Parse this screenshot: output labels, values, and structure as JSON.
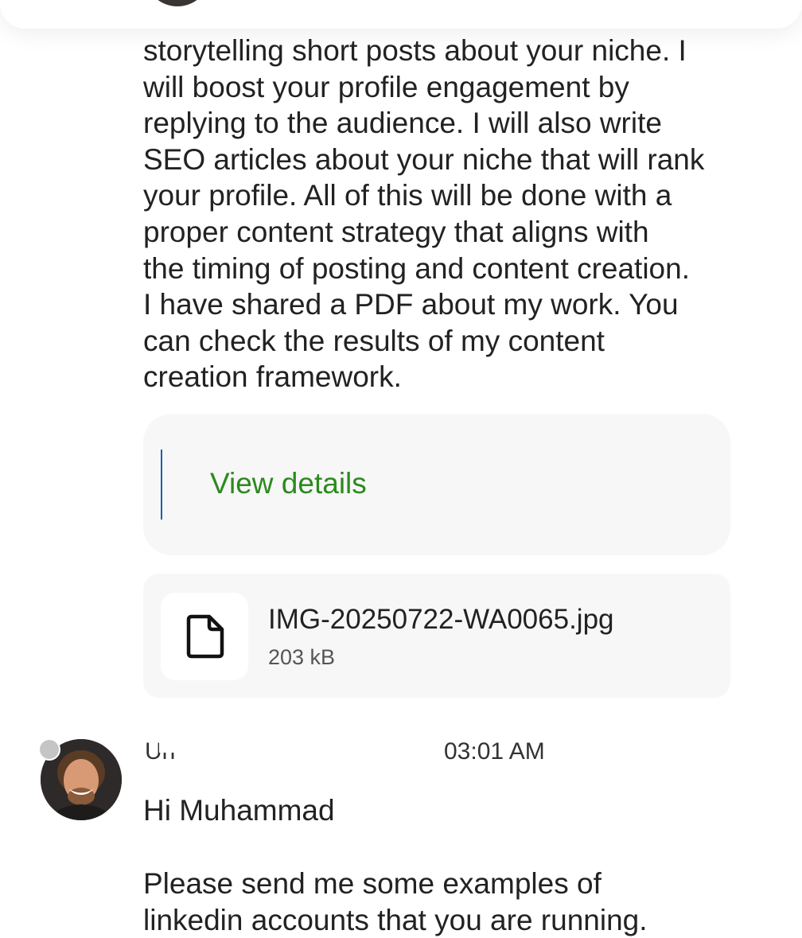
{
  "message_1": {
    "body": "storytelling short posts about your niche. I\nwill boost your profile engagement by\nreplying to the audience. I will also write\nSEO articles about your niche that will rank\nyour profile. All of this will be done with a\nproper content strategy that aligns with\nthe timing of posting and content creation.\nI have shared a PDF about my work. You\ncan check the results of my content\ncreation framework.",
    "link_label": "View details",
    "attachment": {
      "file_name": "IMG-20250722-WA0065.jpg",
      "file_size": "203 kB",
      "icon": "file-icon"
    }
  },
  "message_2": {
    "sender_name_visible": "Un",
    "time": "03:01 AM",
    "greeting": "Hi Muhammad",
    "body": "Please send me some examples of\nlinkedin accounts that you are running."
  },
  "colors": {
    "link_green": "#2b8a1e",
    "quote_bar_blue": "#1a5fb4",
    "card_background": "#f7f7f7"
  }
}
